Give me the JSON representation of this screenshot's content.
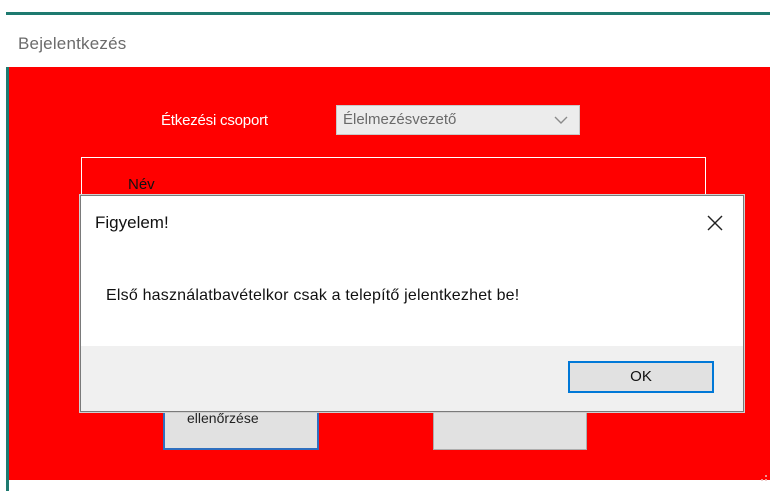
{
  "window": {
    "title": "Bejelentkezés"
  },
  "form": {
    "group_label": "Étkezési csoport",
    "group_value": "Élelmezésvezető",
    "name_label": "Név",
    "check_button_label": "ellenőrzése",
    "other_button_label": ""
  },
  "dialog": {
    "title": "Figyelem!",
    "message": "Első használatbavételkor csak a telepítő jelentkezhet be!",
    "ok_label": "OK"
  },
  "colors": {
    "client_background": "#ff0000",
    "accent": "#0078d7",
    "frame": "#1e7a70"
  },
  "icons": {
    "combo_arrow": "chevron-down-icon",
    "close": "close-icon"
  }
}
